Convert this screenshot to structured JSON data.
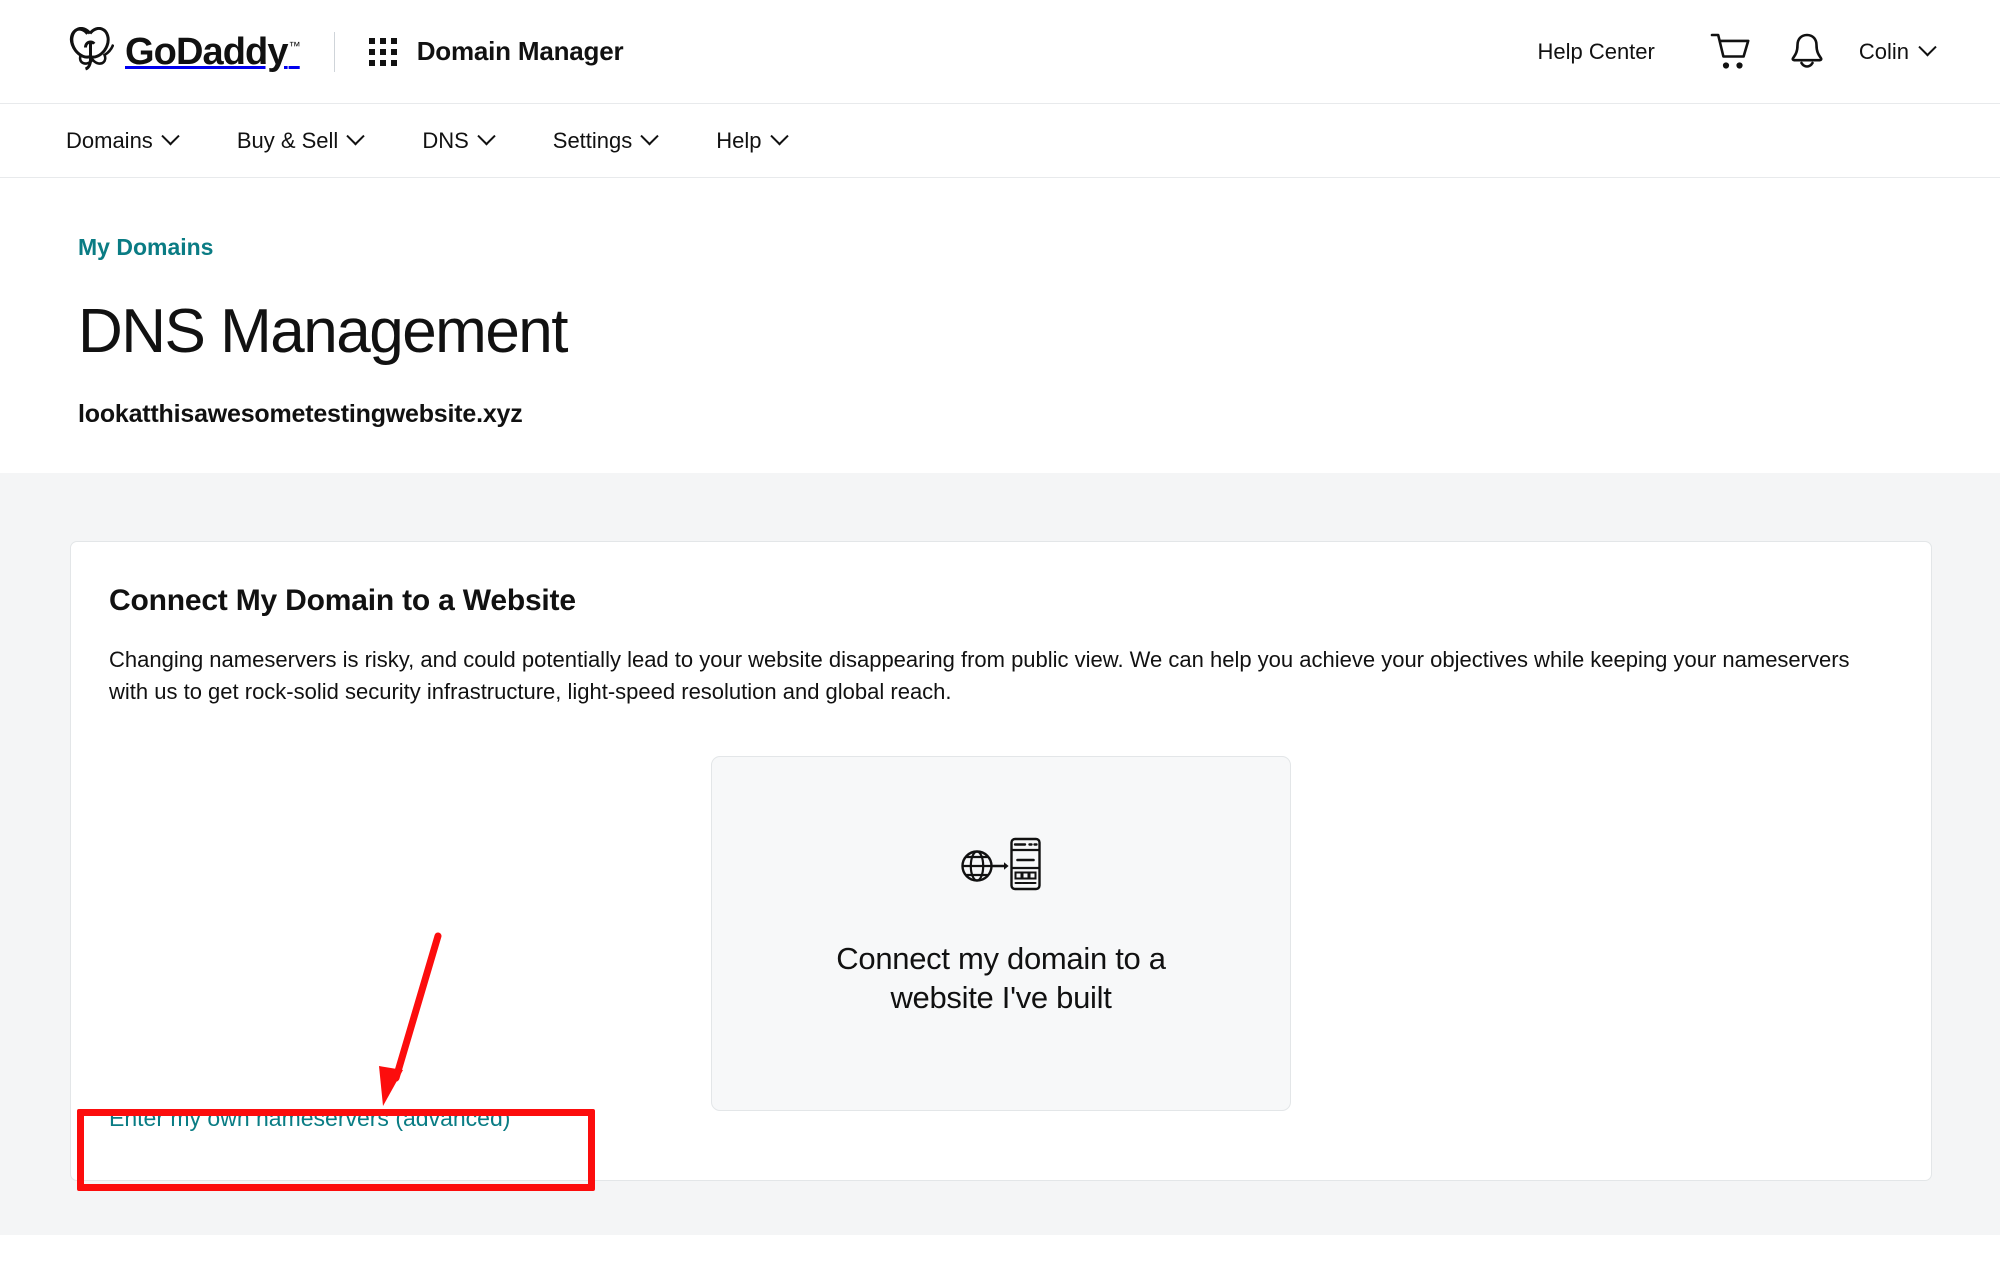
{
  "header": {
    "brand": "GoDaddy",
    "brand_tm": "™",
    "app_name": "Domain Manager",
    "grid_icon": "app-grid-icon",
    "help_center": "Help Center",
    "cart_icon": "shopping-cart-icon",
    "bell_icon": "notification-bell-icon",
    "account_name": "Colin",
    "account_chevron": "chevron-down-icon"
  },
  "nav": {
    "items": [
      {
        "label": "Domains",
        "icon": "chevron-down-icon"
      },
      {
        "label": "Buy & Sell",
        "icon": "chevron-down-icon"
      },
      {
        "label": "DNS",
        "icon": "chevron-down-icon"
      },
      {
        "label": "Settings",
        "icon": "chevron-down-icon"
      },
      {
        "label": "Help",
        "icon": "chevron-down-icon"
      }
    ]
  },
  "page": {
    "breadcrumb": "My Domains",
    "title": "DNS Management",
    "domain": "lookatthisawesometestingwebsite.xyz"
  },
  "panel": {
    "title": "Connect My Domain to a Website",
    "body": "Changing nameservers is risky, and could potentially lead to your website disappearing from public view. We can help you achieve your objectives while keeping your nameservers with us to get rock-solid security infrastructure, light-speed resolution and global reach.",
    "choice_card": {
      "icon": "globe-arrow-webpage-icon",
      "label": "Connect my domain to a website I've built"
    },
    "advanced_link": "Enter my own nameservers (advanced)"
  },
  "annotations": {
    "highlight_box": "red-highlight-box",
    "arrow": "red-pointer-arrow",
    "color": "#fc0d0d"
  },
  "colors": {
    "link_teal": "#0a7c84",
    "page_bg": "#f4f5f6",
    "panel_bg": "#ffffff",
    "choice_card_bg": "#f7f8f9",
    "text": "#111111"
  }
}
